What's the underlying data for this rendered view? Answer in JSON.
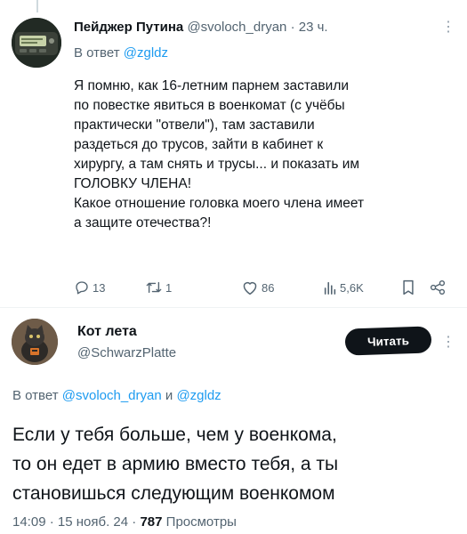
{
  "tweet1": {
    "author_name": "Пейджер Путина",
    "handle": "@svoloch_dryan",
    "separator": "·",
    "time": "23 ч.",
    "more_icon": "more-dots-icon",
    "reply_prefix": "В ответ",
    "reply_handle": "@zgldz",
    "text_lines": [
      "Я помню, как 16-летним парнем заставили",
      "по повестке явиться в военкомат (с учёбы",
      "практически \"отвели\"), там заставили",
      "раздеться до трусов, зайти в кабинет к",
      "хирургу, а там снять и трусы... и показать им",
      "ГОЛОВКУ ЧЛЕНА!",
      "Какое отношение головка моего члена имеет",
      "а защите отечества?!"
    ],
    "actions": {
      "replies": "13",
      "reposts": "1",
      "likes": "86",
      "views": "5,6K"
    }
  },
  "tweet2": {
    "author_name": "Кот лета",
    "handle": "@SchwarzPlatte",
    "read_button": "Читать",
    "reply_prefix": "В ответ",
    "reply_handle1": "@svoloch_dryan",
    "reply_joiner": "и",
    "reply_handle2": "@zgldz",
    "text_lines": [
      "Если у тебя больше, чем у военкома,",
      "то он едет в армию вместо тебя, а ты",
      "становишься следующим военкомом"
    ],
    "meta": {
      "time": "14:09",
      "sep1": "·",
      "date": "15 нояб. 24",
      "sep2": "·",
      "views_count": "787",
      "views_label": "Просмотры"
    }
  },
  "colors": {
    "text": "#0f1419",
    "secondary": "#536471",
    "link": "#1d9bf0",
    "button_bg": "#0f1419"
  }
}
